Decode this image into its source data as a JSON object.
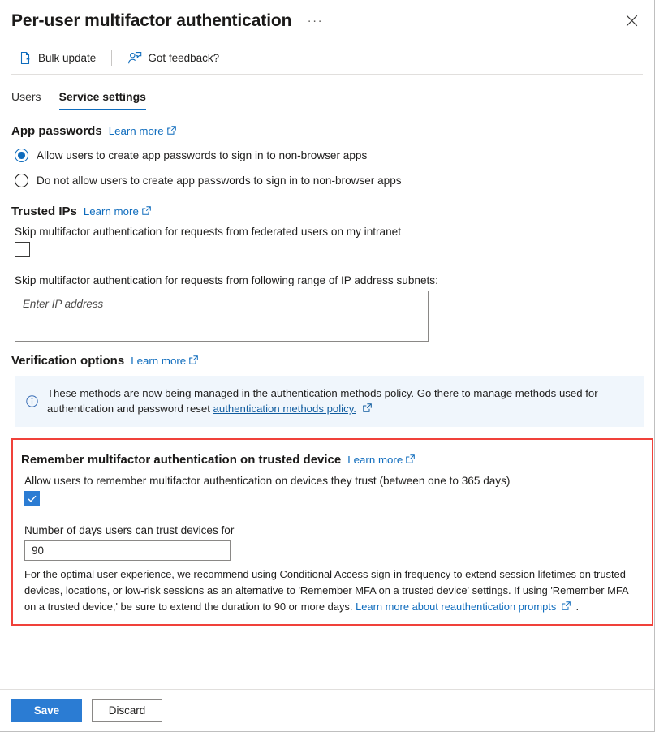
{
  "header": {
    "title": "Per-user multifactor authentication",
    "more_menu_label": "···",
    "close_label": "Close",
    "close_icon": "close-icon",
    "ellipsis_icon": "more-options-icon"
  },
  "commandbar": {
    "items": [
      {
        "label": "Bulk update",
        "icon": "document-upload-icon"
      },
      {
        "label": "Got feedback?",
        "icon": "person-feedback-icon"
      }
    ]
  },
  "tabs": [
    {
      "label": "Users",
      "active": false
    },
    {
      "label": "Service settings",
      "active": true
    }
  ],
  "colors": {
    "accent": "#0f6cbd",
    "primary_button": "#2b7cd3",
    "highlight_border": "#f0413a",
    "info_banner_bg": "#f0f6fc",
    "link": "#0f6cbd",
    "banner_link": "#0f5b9e"
  },
  "app_passwords": {
    "heading": "App passwords",
    "learn_more": "Learn more",
    "learn_more_icon": "external-link-icon",
    "options": [
      {
        "label": "Allow users to create app passwords to sign in to non-browser apps",
        "selected": true
      },
      {
        "label": "Do not allow users to create app passwords to sign in to non-browser apps",
        "selected": false
      }
    ]
  },
  "trusted_ips": {
    "heading": "Trusted IPs",
    "learn_more": "Learn more",
    "learn_more_icon": "external-link-icon",
    "skip_federated_label": "Skip multifactor authentication for requests from federated users on my intranet",
    "skip_federated_checked": false,
    "subnets_label": "Skip multifactor authentication for requests from following range of IP address subnets:",
    "subnets_value": "",
    "subnets_placeholder": "Enter IP address"
  },
  "verification_options": {
    "heading": "Verification options",
    "learn_more": "Learn more",
    "learn_more_icon": "external-link-icon",
    "banner": {
      "icon": "info-circle-icon",
      "text_before": "These methods are now being managed in the authentication methods policy. Go there to manage methods used for authentication and password reset",
      "link_text": "authentication methods policy.",
      "link_icon": "external-link-icon"
    }
  },
  "remember_mfa": {
    "heading": "Remember multifactor authentication on trusted device",
    "learn_more": "Learn more",
    "learn_more_icon": "external-link-icon",
    "allow_label": "Allow users to remember multifactor authentication on devices they trust (between one to 365 days)",
    "allow_checked": true,
    "checkbox_icon": "checkmark-icon",
    "days_label": "Number of days users can trust devices for",
    "days_value": "90",
    "helper_text_before": "For the optimal user experience, we recommend using Conditional Access sign-in frequency to extend session lifetimes on trusted devices, locations, or low-risk sessions as an alternative to 'Remember MFA on a trusted device' settings. If using 'Remember MFA on a trusted device,' be sure to extend the duration to 90 or more days.",
    "helper_link": "Learn more about reauthentication prompts",
    "helper_link_icon": "external-link-icon",
    "helper_text_after": "."
  },
  "footer": {
    "save_label": "Save",
    "discard_label": "Discard"
  }
}
